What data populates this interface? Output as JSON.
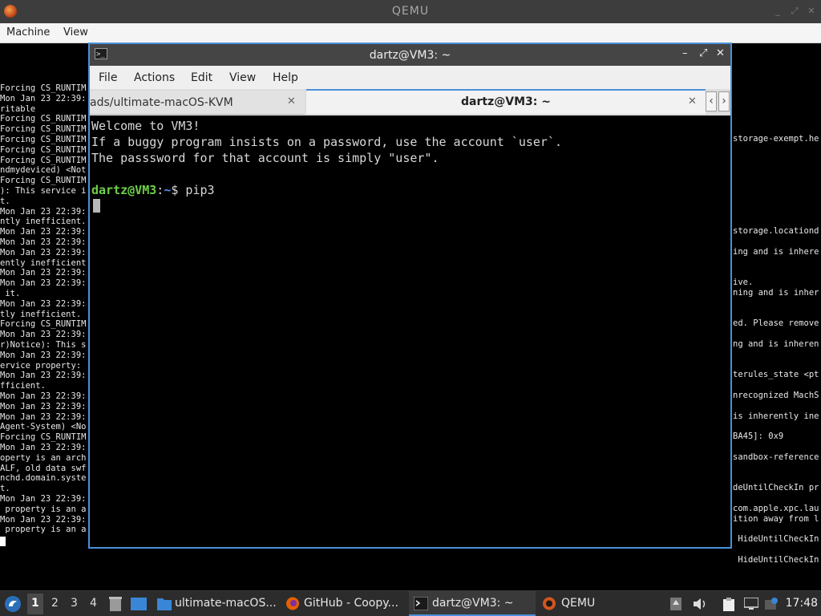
{
  "qemu": {
    "title": "QEMU",
    "menu": [
      "Machine",
      "View"
    ]
  },
  "console_left": [
    "Forcing CS_RUNTIM",
    "Mon Jan 23 22:39:",
    "ritable",
    "Forcing CS_RUNTIM",
    "Forcing CS_RUNTIM",
    "Forcing CS_RUNTIM",
    "Forcing CS_RUNTIM",
    "Forcing CS_RUNTIM",
    "ndmydeviced) <Not",
    "Forcing CS_RUNTIM",
    "): This service i",
    "t.",
    "Mon Jan 23 22:39:",
    "ntly inefficient.",
    "Mon Jan 23 22:39:",
    "Mon Jan 23 22:39:",
    "Mon Jan 23 22:39:",
    "ently inefficient",
    "Mon Jan 23 22:39:",
    "Mon Jan 23 22:39:",
    " it.",
    "Mon Jan 23 22:39:",
    "tly inefficient.",
    "Forcing CS_RUNTIM",
    "Mon Jan 23 22:39:",
    "r)Notice): This s",
    "Mon Jan 23 22:39:",
    "ervice property: ",
    "Mon Jan 23 22:39:",
    "fficient.",
    "Mon Jan 23 22:39:",
    "Mon Jan 23 22:39:",
    "Mon Jan 23 22:39:",
    "Agent-System) <No",
    "Forcing CS_RUNTIM",
    "Mon Jan 23 22:39:",
    "operty is an arch",
    "ALF, old data swf",
    "nchd.domain.syste",
    "t.",
    "Mon Jan 23 22:39:",
    " property is an a",
    "Mon Jan 23 22:39:",
    " property is an a"
  ],
  "console_right": [
    {
      "line": 5,
      "text": "storage-exempt.he"
    },
    {
      "line": 14,
      "text": "storage.locationd"
    },
    {
      "line": 16,
      "text": "ing and is inhere"
    },
    {
      "line": 19,
      "text": "ive."
    },
    {
      "line": 20,
      "text": "ning and is inher"
    },
    {
      "line": 23,
      "text": "ed. Please remove"
    },
    {
      "line": 25,
      "text": "ng and is inheren"
    },
    {
      "line": 28,
      "text": "terules_state <pt"
    },
    {
      "line": 30,
      "text": "nrecognized MachS"
    },
    {
      "line": 32,
      "text": "is inherently ine"
    },
    {
      "line": 34,
      "text": "BA45]: 0x9"
    },
    {
      "line": 36,
      "text": "sandbox-reference"
    },
    {
      "line": 39,
      "text": "deUntilCheckIn pr"
    },
    {
      "line": 41,
      "text": "com.apple.xpc.lau"
    },
    {
      "line": 42,
      "text": "ition away from l"
    },
    {
      "line": 44,
      "text": " HideUntilCheckIn"
    },
    {
      "line": 46,
      "text": " HideUntilCheckIn"
    }
  ],
  "terminal": {
    "title": "dartz@VM3: ~",
    "menu": [
      "File",
      "Actions",
      "Edit",
      "View",
      "Help"
    ],
    "tabs": [
      {
        "label": "ads/ultimate-macOS-KVM",
        "active": false
      },
      {
        "label": "dartz@VM3: ~",
        "active": true
      }
    ],
    "lines": [
      "Welcome to VM3!",
      "If a buggy program insists on a password, use the account `user`.",
      "The passsword for that account is simply \"user\"."
    ],
    "prompt_user": "dartz@VM3",
    "prompt_colon": ":",
    "prompt_path": "~",
    "prompt_symbol": "$ ",
    "command": "pip3"
  },
  "taskbar": {
    "workspaces": [
      "1",
      "2",
      "3",
      "4"
    ],
    "active_workspace": "1",
    "items": [
      {
        "label": "ultimate-macOS...",
        "icon": "folder-icon"
      },
      {
        "label": "GitHub - Coopy...",
        "icon": "firefox-icon"
      },
      {
        "label": "dartz@VM3: ~",
        "icon": "terminal-icon"
      },
      {
        "label": "QEMU",
        "icon": "qemu-icon"
      }
    ],
    "clock": "17:48"
  },
  "colors": {
    "accent": "#4a90d9",
    "prompt_user": "#6fd04a",
    "prompt_path": "#5b8ee8"
  }
}
